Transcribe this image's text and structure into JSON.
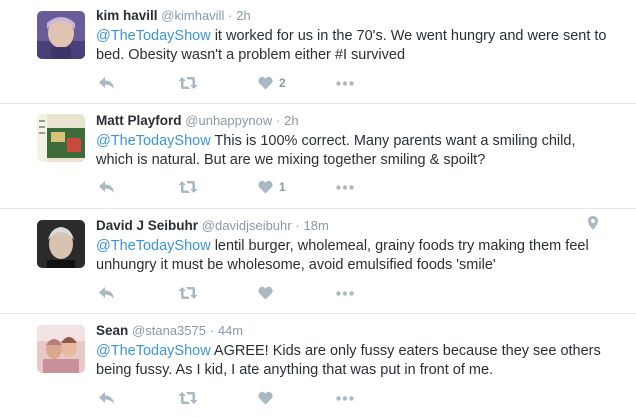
{
  "tweets": [
    {
      "name": "kim havill",
      "handle": "@kimhavill",
      "dot": "·",
      "time": "2h",
      "mention": "@TheTodayShow",
      "text": " it worked for us in the 70's. We went hungry and were sent to bed. Obesity wasn't a problem either #I survived",
      "likes": "2",
      "avatar_colors": [
        "#6a5c9a",
        "#c8b7d8"
      ]
    },
    {
      "name": "Matt Playford",
      "handle": "@unhappynow",
      "dot": "·",
      "time": "2h",
      "mention": "@TheTodayShow",
      "text": " This is 100% correct. Many parents want a smiling child, which is natural. But are we mixing together smiling & spoilt?",
      "likes": "1",
      "avatar_colors": [
        "#d9c27a",
        "#3d6b3a"
      ]
    },
    {
      "name": "David J Seibuhr",
      "handle": "@davidjseibuhr",
      "dot": "·",
      "time": "18m",
      "mention": "@TheTodayShow",
      "text": " lentil burger, wholemeal, grainy foods try making them feel unhungry it must be wholesome, avoid emulsified foods 'smile'",
      "likes": "",
      "avatar_colors": [
        "#2b2b2b",
        "#dcdcdc"
      ]
    },
    {
      "name": "Sean",
      "handle": "@stana3575",
      "dot": "·",
      "time": "44m",
      "mention": "@TheTodayShow",
      "text": " AGREE! Kids are only fussy eaters because they see others being fussy. As I kid, I ate anything that was put in front of me.",
      "likes": "",
      "avatar_colors": [
        "#e8c9c9",
        "#b67d7d"
      ]
    }
  ],
  "icons": {
    "reply": "reply-icon",
    "retweet": "retweet-icon",
    "like": "heart-icon",
    "more": "more-icon",
    "location": "location-pin-icon"
  },
  "colors": {
    "mention": "#3b94d9",
    "icon": "#aab8c2",
    "meta": "#8899a6"
  }
}
